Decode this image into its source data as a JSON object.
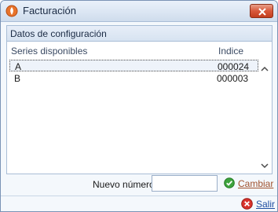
{
  "window": {
    "title": "Facturación",
    "icon": "flame-icon",
    "close_icon": "close-icon"
  },
  "group": {
    "title": "Datos de configuración",
    "list": {
      "columns": [
        "Series disponibles",
        "Indice"
      ],
      "rows": [
        {
          "series": "A",
          "indice": "000024",
          "selected": true
        },
        {
          "series": "B",
          "indice": "000003",
          "selected": false
        }
      ]
    }
  },
  "footer": {
    "nuevo_numero_label": "Nuevo número",
    "nuevo_numero_value": "",
    "cambiar_label": "Cambiar",
    "cambiar_icon": "check-circle-icon"
  },
  "bottom": {
    "salir_label": "Salir",
    "salir_icon": "red-x-circle-icon"
  },
  "colors": {
    "accent_blue": "#1f4ea1",
    "link_brown": "#a0522d",
    "close_red": "#d8583a"
  }
}
